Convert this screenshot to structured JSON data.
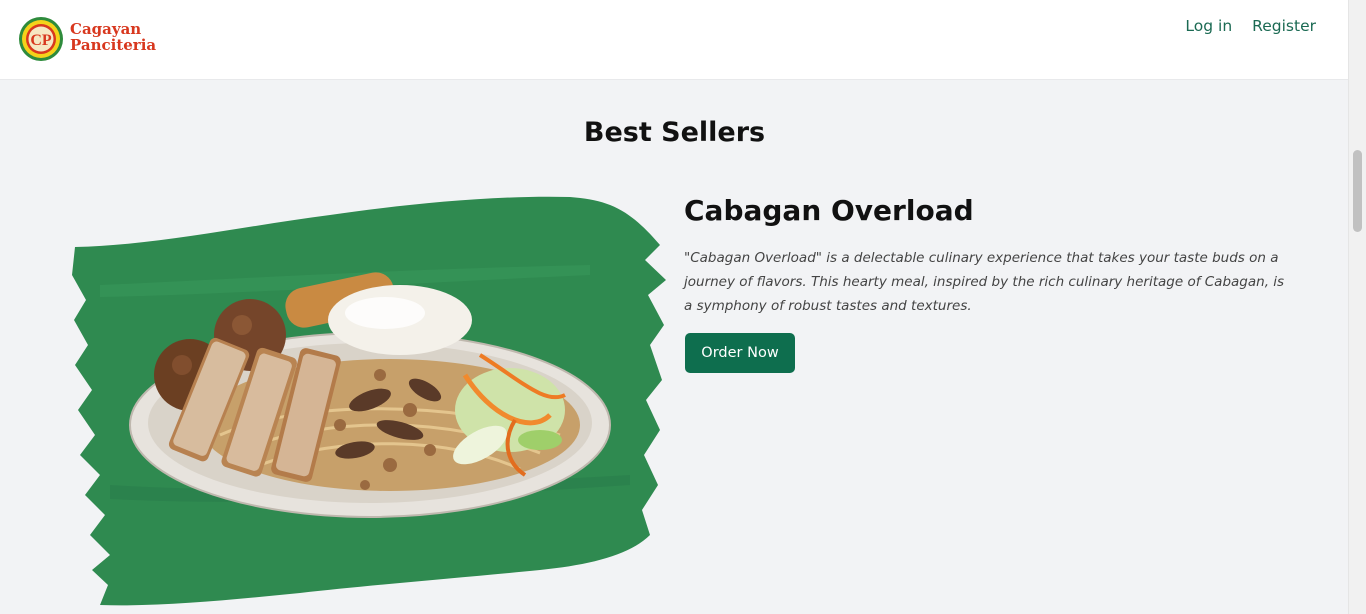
{
  "header": {
    "logo_initials": "CP",
    "brand_line1": "Cagayan",
    "brand_line2": "Panciteria",
    "nav": {
      "login": "Log in",
      "register": "Register"
    }
  },
  "main": {
    "section_title": "Best Sellers",
    "featured": {
      "name": "Cabagan Overload",
      "description": "\"Cabagan Overload\" is a delectable culinary experience that takes your taste buds on a journey of flavors. This hearty meal, inspired by the rich culinary heritage of Cabagan, is a symphony of robust tastes and textures.",
      "order_button": "Order Now"
    }
  },
  "colors": {
    "accent": "#0e6e4e",
    "link": "#1b6a53",
    "brand_red": "#d8371e",
    "hero_green": "#2f8a50"
  }
}
